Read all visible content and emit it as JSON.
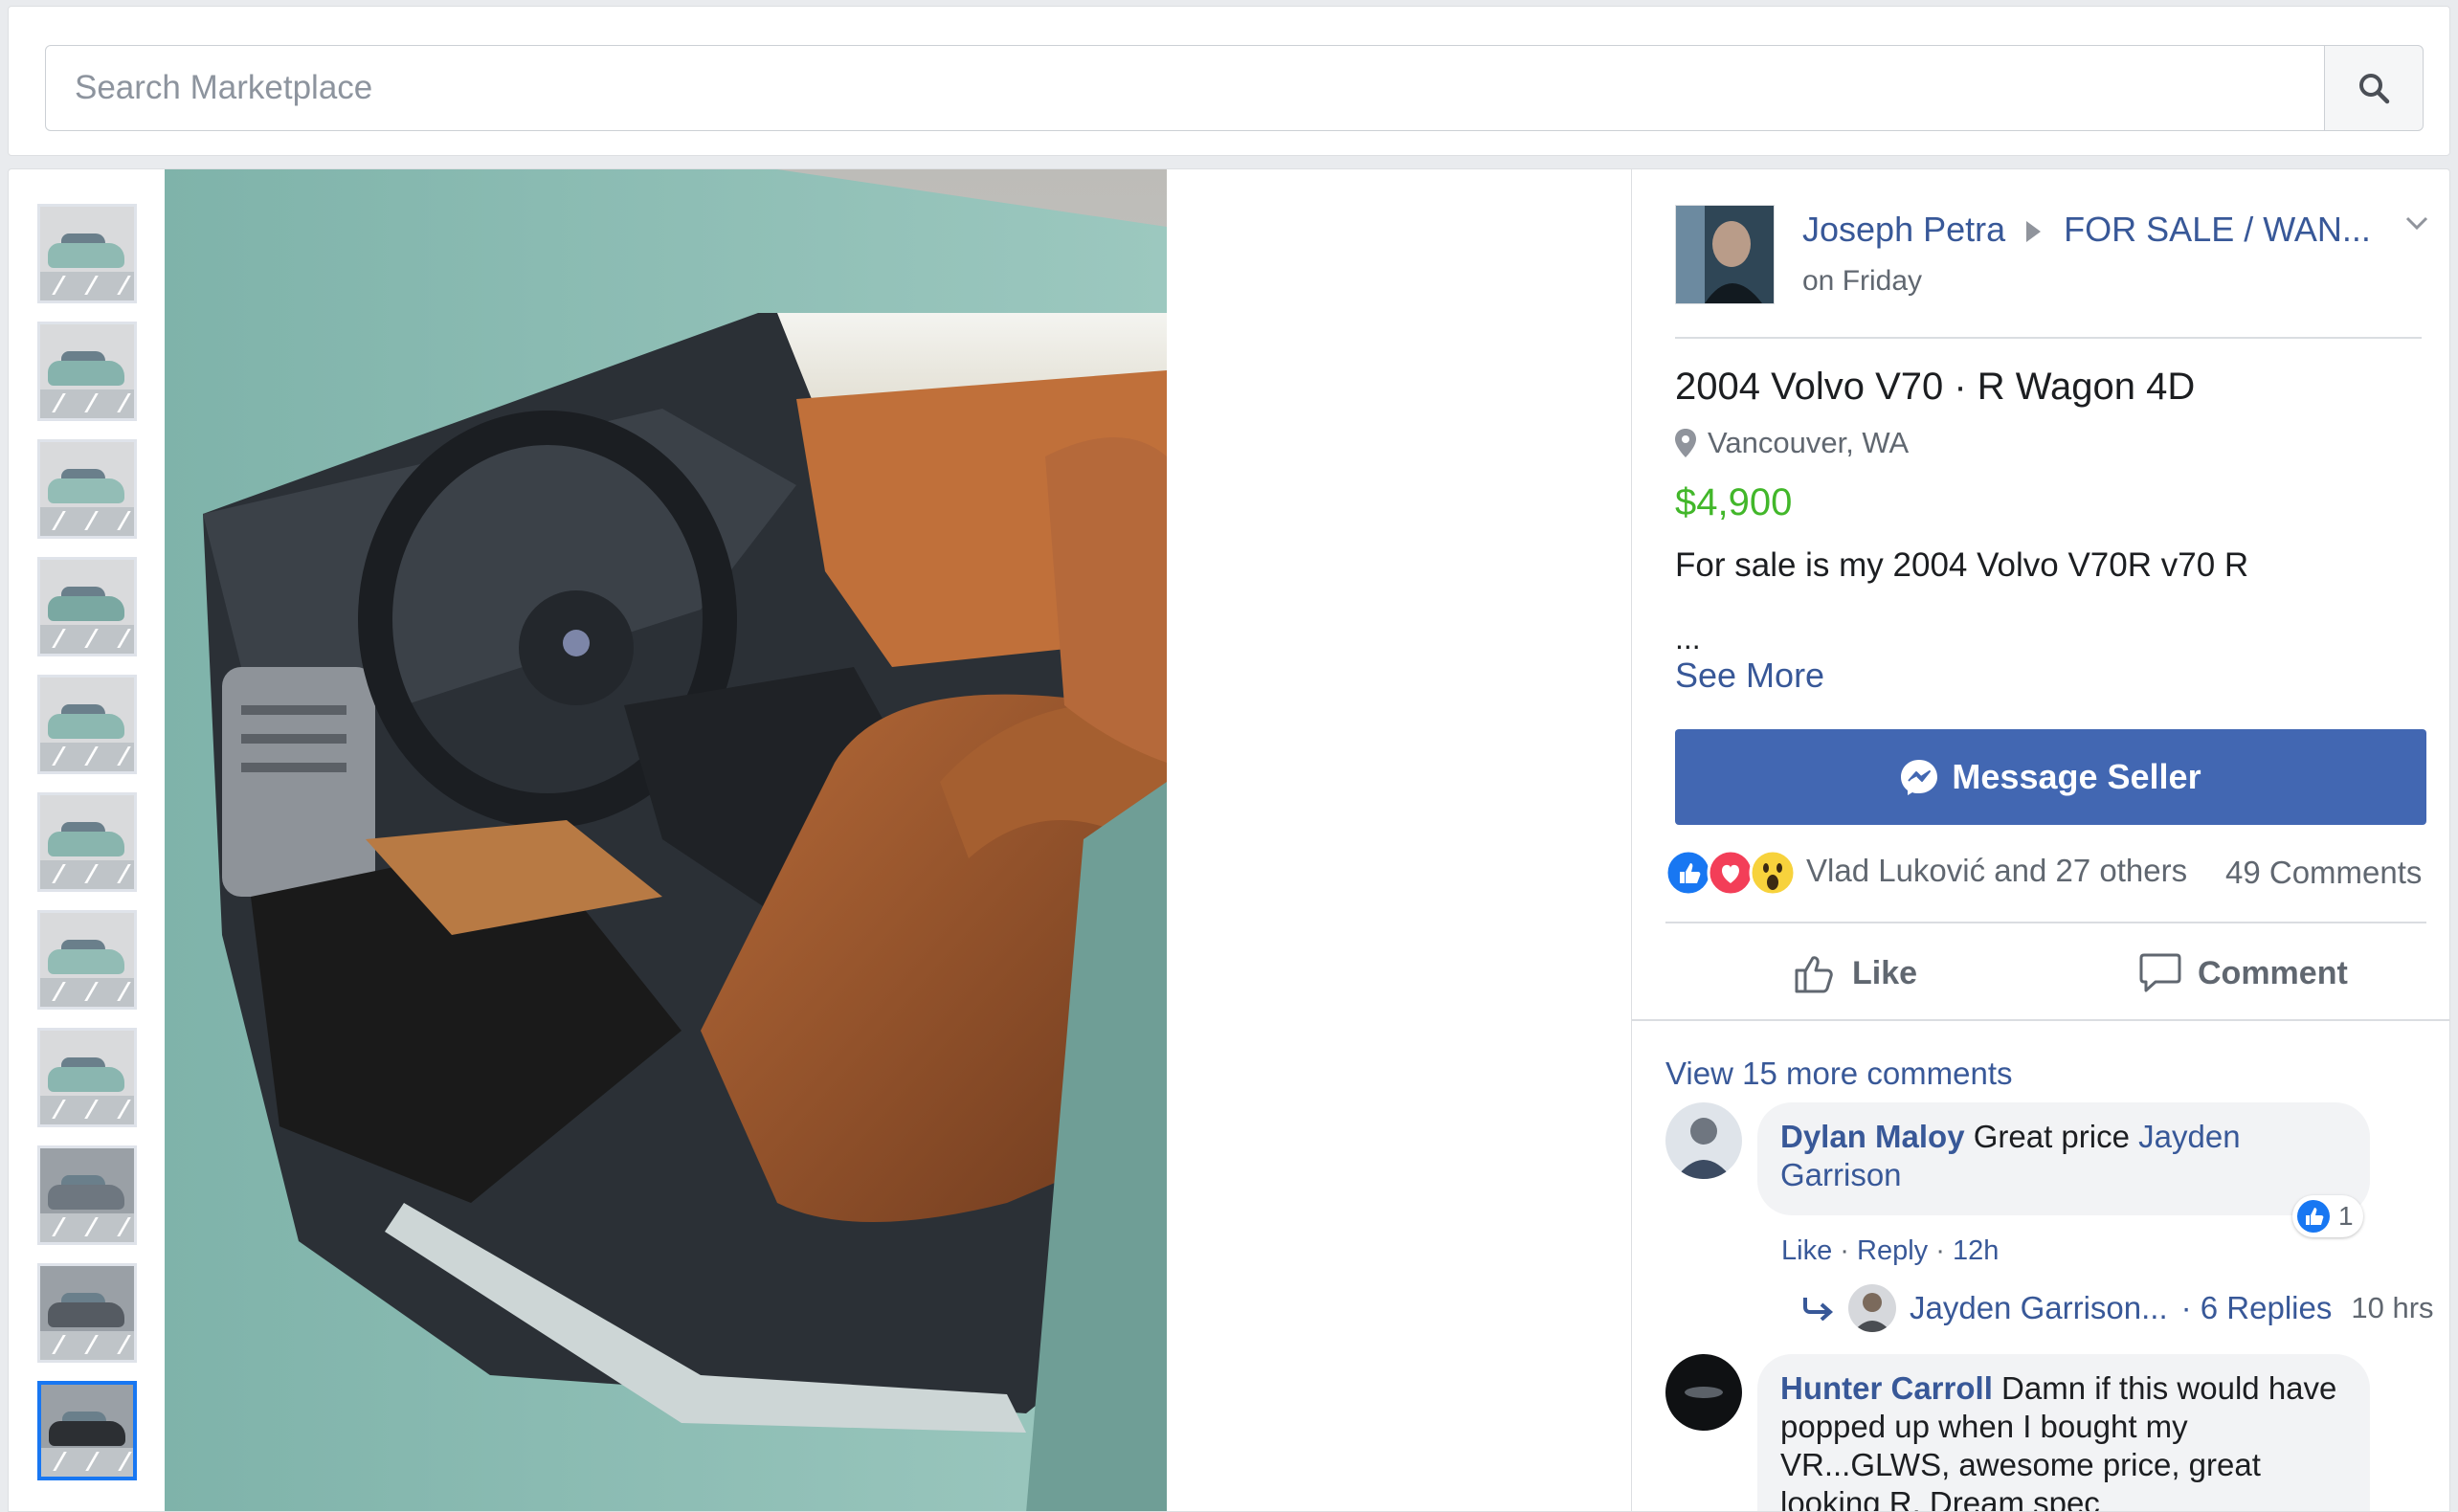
{
  "search": {
    "placeholder": "Search Marketplace"
  },
  "post": {
    "author": "Joseph Petra",
    "group": "FOR SALE / WAN...",
    "time": "on Friday"
  },
  "listing": {
    "title": "2004 Volvo V70 · R Wagon 4D",
    "location": "Vancouver, WA",
    "price": "$4,900",
    "description": "For sale is my 2004 Volvo V70R v70 R",
    "ellipsis": "...",
    "see_more": "See More",
    "message_button": "Message Seller"
  },
  "reactions": {
    "summary": "Vlad Luković and 27 others",
    "comments_count": "49 Comments",
    "like_label": "Like",
    "comment_label": "Comment",
    "icons": [
      "like-reaction-icon",
      "love-reaction-icon",
      "wow-reaction-icon"
    ]
  },
  "comments": {
    "view_more": "View 15 more comments",
    "items": [
      {
        "author": "Dylan Maloy",
        "text": "Great price",
        "mention": "Jayden Garrison",
        "like": "Like",
        "reply": "Reply",
        "time": "12h",
        "like_count": "1",
        "replies": {
          "author": "Jayden Garrison...",
          "count": "· 6 Replies",
          "time": "10 hrs"
        }
      },
      {
        "author": "Hunter Carroll",
        "text": "Damn if this would have popped up when I bought my VR...GLWS, awesome price, great looking R. Dream spec"
      }
    ]
  },
  "thumbnails": {
    "count": 11,
    "active_index": 10
  },
  "colors": {
    "accent": "#4267b2",
    "link": "#385898",
    "price": "#42b72a",
    "page_bg": "#e9ebee",
    "active_thumb": "#1877f2"
  }
}
